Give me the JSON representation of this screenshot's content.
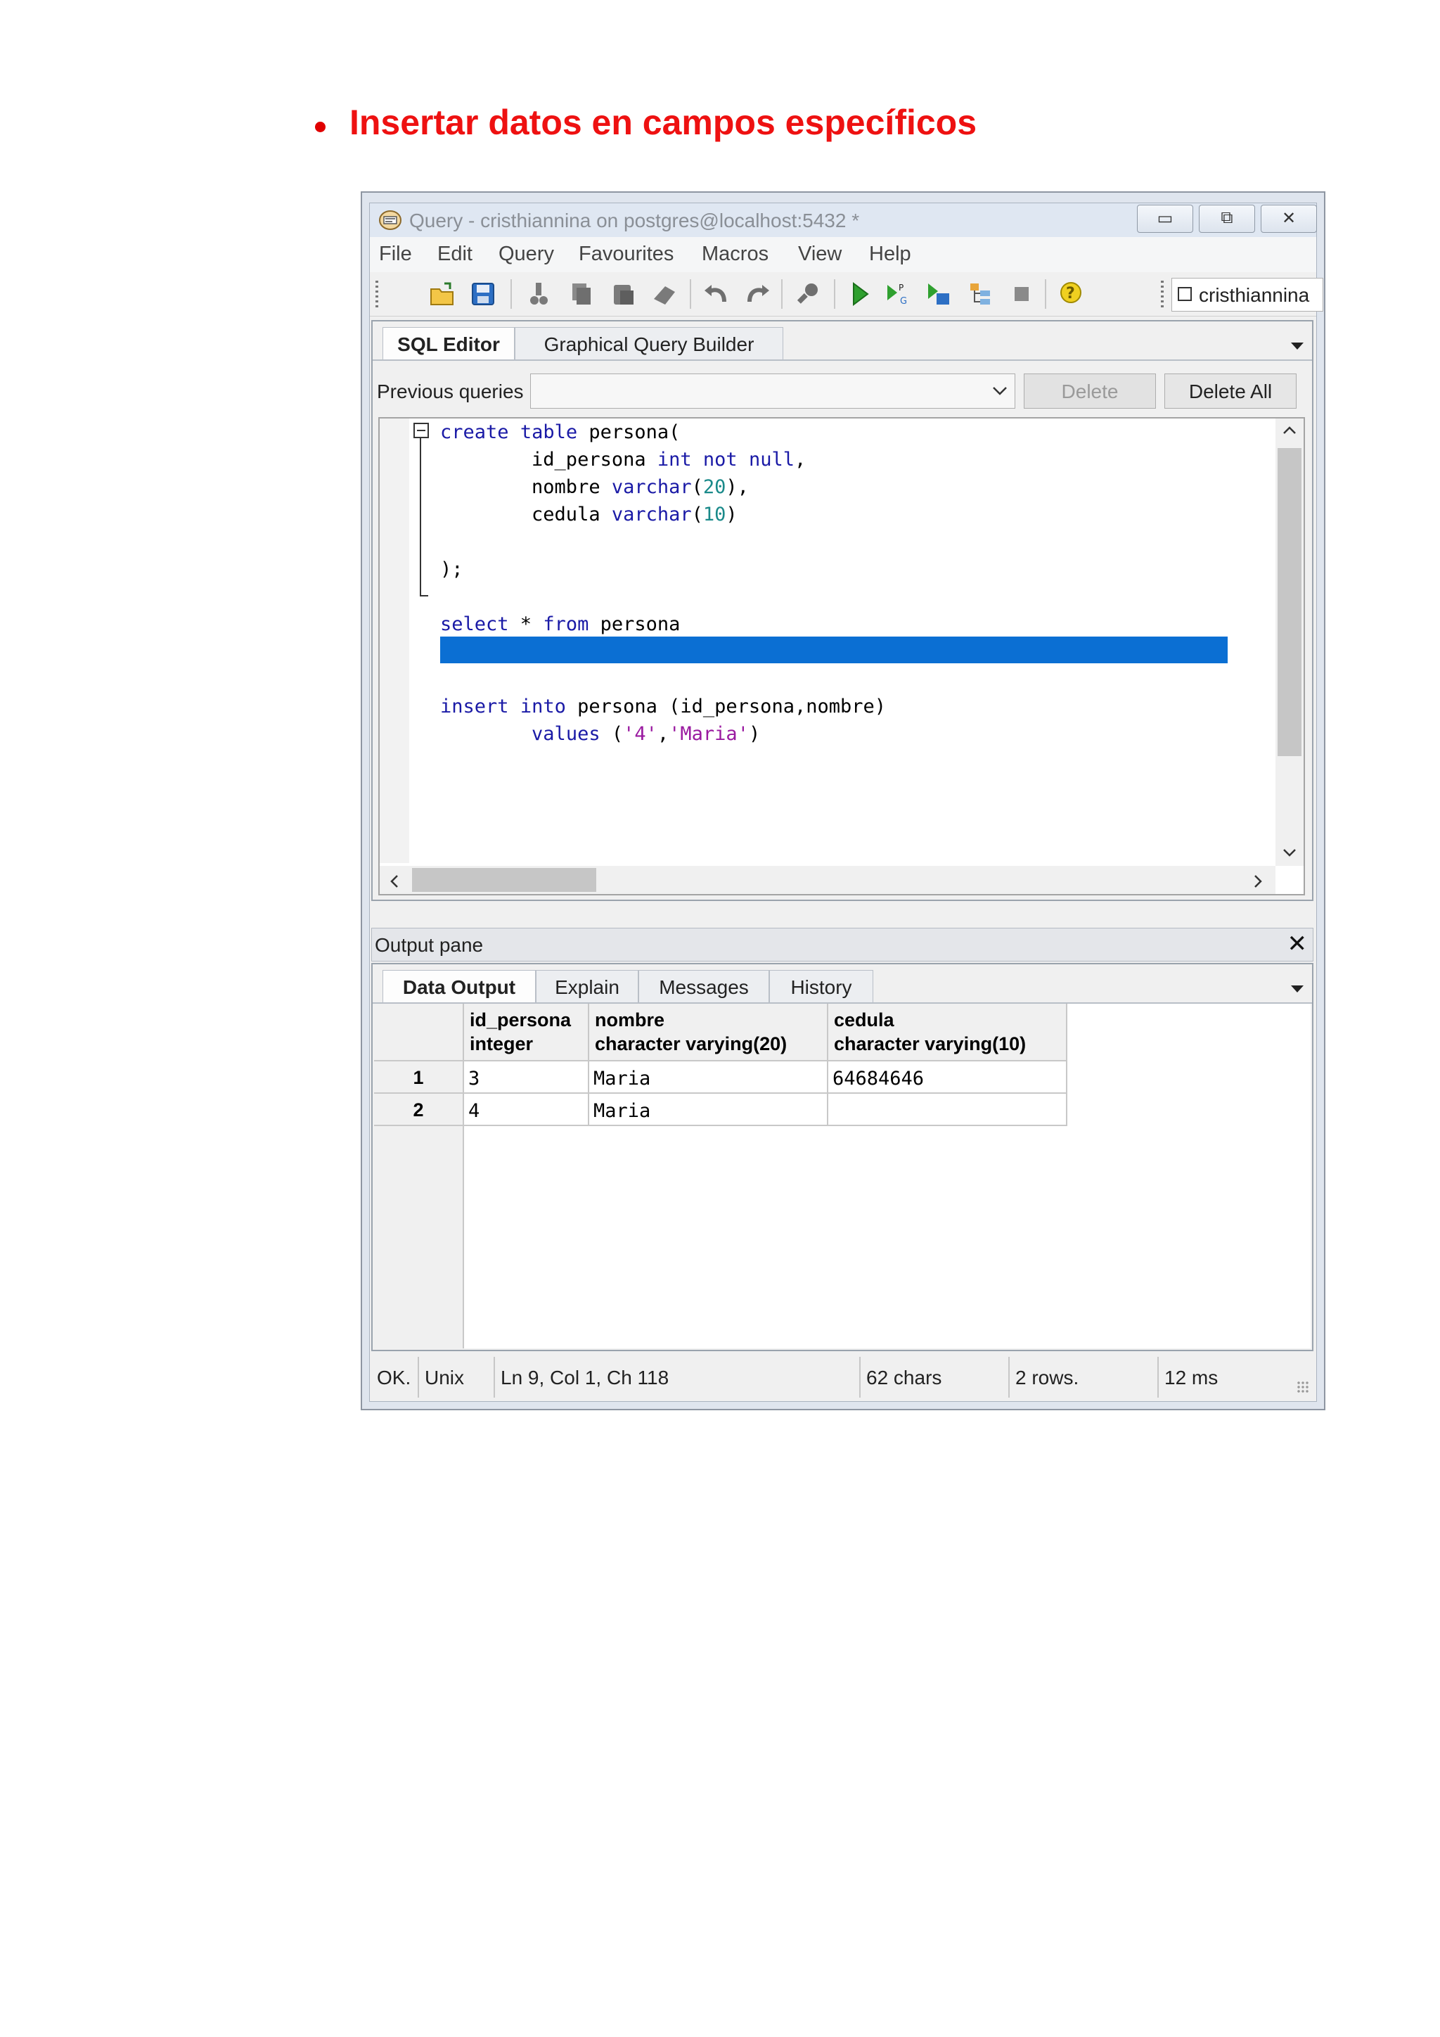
{
  "heading": "Insertar datos en campos específicos",
  "window": {
    "title": "Query - cristhiannina on postgres@localhost:5432 *",
    "minimize_glyph": "▭",
    "maximize_glyph": "⧉",
    "close_glyph": "✕",
    "menu": [
      "File",
      "Edit",
      "Query",
      "Favourites",
      "Macros",
      "View",
      "Help"
    ],
    "toolbar_icons": [
      "open-file-icon",
      "save-icon",
      "cut-icon",
      "copy-icon",
      "paste-icon",
      "clear-icon",
      "undo-icon",
      "redo-icon",
      "find-icon",
      "execute-icon",
      "execute-pgscript-icon",
      "execute-to-file-icon",
      "explain-icon",
      "stop-icon",
      "help-icon"
    ],
    "database": "cristhiannina"
  },
  "editor_tabs": [
    "SQL Editor",
    "Graphical Query Builder"
  ],
  "previous_queries_label": "Previous queries",
  "previous_queries_value": "",
  "delete_label": "Delete",
  "delete_all_label": "Delete All",
  "code": [
    {
      "parts": [
        [
          "kw",
          "create"
        ],
        [
          "t",
          " "
        ],
        [
          "kw",
          "table"
        ],
        [
          "t",
          " persona("
        ]
      ]
    },
    {
      "parts": [
        [
          "t",
          "        id_persona "
        ],
        [
          "kw",
          "int"
        ],
        [
          "t",
          " "
        ],
        [
          "kw",
          "not"
        ],
        [
          "t",
          " "
        ],
        [
          "kw",
          "null"
        ],
        [
          "t",
          ","
        ]
      ]
    },
    {
      "parts": [
        [
          "t",
          "        nombre "
        ],
        [
          "kw",
          "varchar"
        ],
        [
          "t",
          "("
        ],
        [
          "num",
          "20"
        ],
        [
          "t",
          "),"
        ]
      ]
    },
    {
      "parts": [
        [
          "t",
          "        cedula "
        ],
        [
          "kw",
          "varchar"
        ],
        [
          "t",
          "("
        ],
        [
          "num",
          "10"
        ],
        [
          "t",
          ")"
        ]
      ]
    },
    {
      "parts": [
        [
          "t",
          ""
        ]
      ]
    },
    {
      "parts": [
        [
          "t",
          ");"
        ]
      ]
    },
    {
      "parts": [
        [
          "t",
          ""
        ]
      ]
    },
    {
      "parts": [
        [
          "kw",
          "select"
        ],
        [
          "t",
          " * "
        ],
        [
          "kw",
          "from"
        ],
        [
          "t",
          " persona"
        ]
      ]
    },
    {
      "parts": [
        [
          "t",
          ""
        ]
      ]
    },
    {
      "parts": [
        [
          "t",
          ""
        ]
      ]
    },
    {
      "parts": [
        [
          "kw",
          "insert"
        ],
        [
          "t",
          " "
        ],
        [
          "kw",
          "into"
        ],
        [
          "t",
          " persona (id_persona,nombre)"
        ]
      ]
    },
    {
      "parts": [
        [
          "t",
          "        "
        ],
        [
          "kw",
          "values"
        ],
        [
          "t",
          " ("
        ],
        [
          "str",
          "'4'"
        ],
        [
          "t",
          ","
        ],
        [
          "str",
          "'Maria'"
        ],
        [
          "t",
          ")"
        ]
      ]
    }
  ],
  "output": {
    "title": "Output pane",
    "close_glyph": "✕",
    "tabs": [
      "Data Output",
      "Explain",
      "Messages",
      "History"
    ],
    "columns": [
      {
        "name": "id_persona",
        "type": "integer"
      },
      {
        "name": "nombre",
        "type": "character varying(20)"
      },
      {
        "name": "cedula",
        "type": "character varying(10)"
      }
    ],
    "rows": [
      {
        "num": "1",
        "cells": [
          "3",
          "Maria",
          "64684646"
        ]
      },
      {
        "num": "2",
        "cells": [
          "4",
          "Maria",
          ""
        ]
      }
    ]
  },
  "status": {
    "state": "OK.",
    "line_ending": "Unix",
    "position": "Ln 9, Col 1, Ch 118",
    "chars": "62 chars",
    "rows": "2 rows.",
    "time": "12 ms"
  }
}
